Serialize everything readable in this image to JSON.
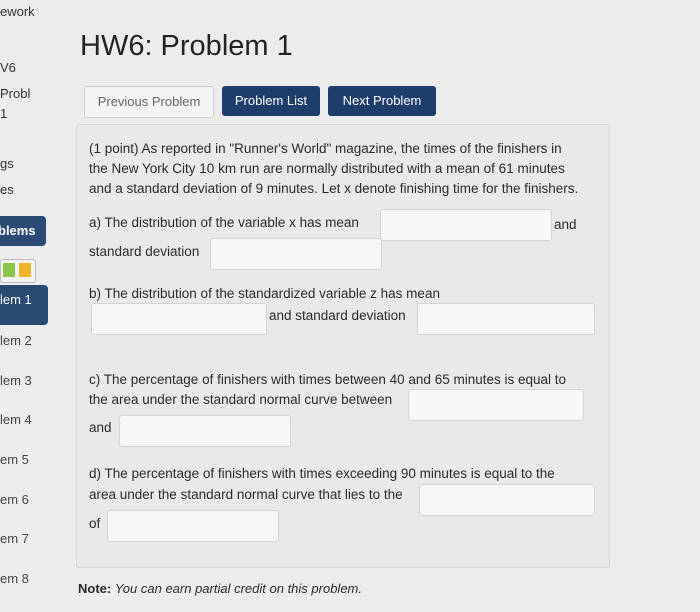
{
  "sidebar": {
    "frag_top": "ework",
    "frag_set": "V6",
    "frag_problem": "Probl",
    "frag_one": "1",
    "frag_gs": "gs",
    "frag_es": "es",
    "problems_label": "blems",
    "active_item": "lem 1",
    "items": [
      "lem 2",
      "lem 3",
      "lem 4",
      "em 5",
      "em 6",
      "em 7",
      "em 8"
    ]
  },
  "title": "HW6: Problem 1",
  "nav": {
    "previous": "Previous Problem",
    "list": "Problem List",
    "next": "Next Problem"
  },
  "problem": {
    "intro_l1": "(1 point) As reported in \"Runner's World\" magazine, the times of the finishers in",
    "intro_l2": "the New York City 10 km run are normally distributed with a mean of 61 minutes",
    "intro_l3": "and a standard deviation of 9 minutes. Let x denote finishing time for the finishers.",
    "a_text": "a) The distribution of the variable x has mean",
    "a_and": "and",
    "a_sd": "standard deviation",
    "b_text": "b) The distribution of the standardized variable z has mean",
    "b_sd": "and standard deviation",
    "c_l1": "c) The percentage of finishers with times between 40 and 65 minutes is equal to",
    "c_l2": "the area under the standard normal curve between",
    "c_and": "and",
    "d_l1": "d) The percentage of finishers with times exceeding 90 minutes is equal to the",
    "d_l2": "area under the standard normal curve that lies to the",
    "d_of": "of",
    "answers": {
      "a_mean": "",
      "a_sd": "",
      "b_mean": "",
      "b_sd": "",
      "c_low": "",
      "c_high": "",
      "d_side": "",
      "d_value": ""
    }
  },
  "note": {
    "label": "Note:",
    "text": "You can earn partial credit on this problem."
  }
}
